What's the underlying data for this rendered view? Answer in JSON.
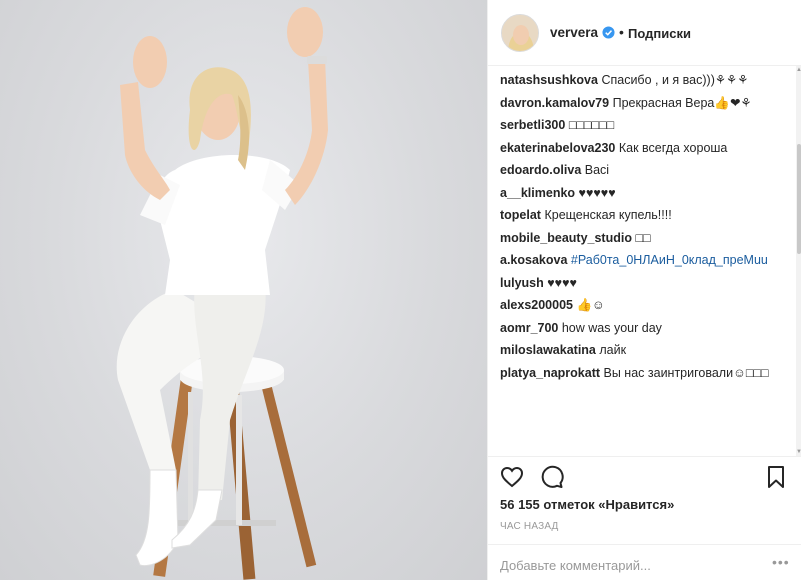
{
  "post": {
    "author": "ververa",
    "follow_label": "Подписки",
    "separator": "•"
  },
  "comments": [
    {
      "user": "natashsushkova",
      "text": "Спасибо , и я вас)))⚘⚘⚘"
    },
    {
      "user": "davron.kamalov79",
      "text": "Прекрасная Вера👍❤⚘"
    },
    {
      "user": "serbetli300",
      "text": "□□□□□□"
    },
    {
      "user": "ekaterinabelova230",
      "text": "Как всегда хороша"
    },
    {
      "user": "edoardo.oliva",
      "text": "Baci"
    },
    {
      "user": "a__klimenko",
      "text": "♥♥♥♥♥"
    },
    {
      "user": "topelat",
      "text": "Крещенская купель!!!!"
    },
    {
      "user": "mobile_beauty_studio",
      "text": "□□"
    },
    {
      "user": "a.kosakova",
      "text": "#Раб0та_0НЛАиН_0клад_преМuu",
      "is_tag": true
    },
    {
      "user": "lulyush",
      "text": "♥♥♥♥"
    },
    {
      "user": "alexs200005",
      "text": "👍☺"
    },
    {
      "user": "aomr_700",
      "text": "how was your day"
    },
    {
      "user": "miloslawakatina",
      "text": "лайк"
    },
    {
      "user": "platya_naprokatt",
      "text": "Вы нас заинтриговали☺□□□"
    }
  ],
  "actions": {
    "like_icon": "heart-icon",
    "comment_icon": "comment-icon",
    "save_icon": "bookmark-icon"
  },
  "likes_text": "56 155 отметок «Нравится»",
  "time_ago": "ЧАС НАЗАД",
  "add_comment": {
    "placeholder": "Добавьте комментарий..."
  },
  "more_label": "•••",
  "colors": {
    "accent": "#3897f0",
    "hashtag": "#1a5c9e",
    "text": "#262626",
    "muted": "#999999"
  }
}
